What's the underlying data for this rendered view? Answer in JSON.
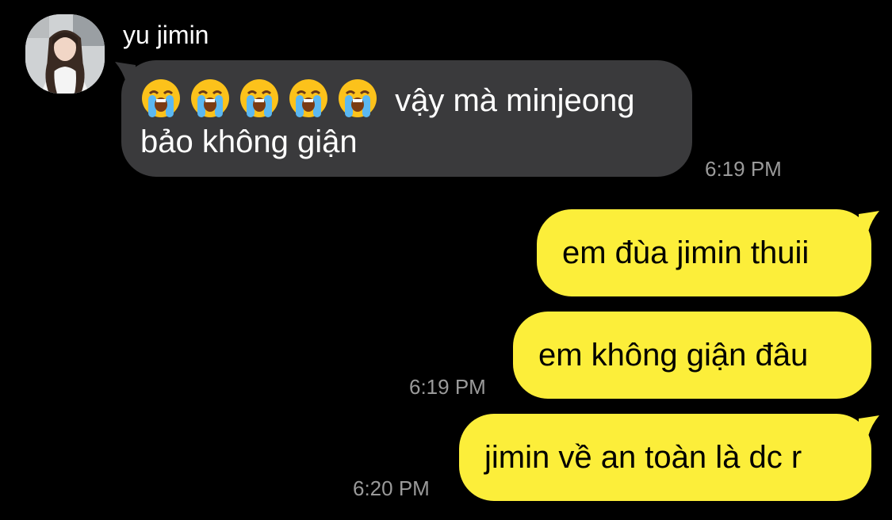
{
  "conversation": {
    "contact_name": "yu jimin",
    "incoming_message": {
      "emojis": [
        "loudly-crying-face-emoji",
        "loudly-crying-face-emoji",
        "loudly-crying-face-emoji",
        "loudly-crying-face-emoji",
        "loudly-crying-face-emoji"
      ],
      "text": " vậy mà minjeong bảo không giận",
      "time": "6:19 PM"
    },
    "outgoing_messages": [
      {
        "text": "em đùa jimin thuii"
      },
      {
        "text": "em không giận đâu",
        "time": "6:19 PM"
      },
      {
        "text": "jimin về an toàn là dc r",
        "time": "6:20 PM"
      }
    ]
  },
  "colors": {
    "background": "#000000",
    "incoming_bubble": "#3a3a3c",
    "outgoing_bubble": "#fcee3a",
    "timestamp": "#9a9a9a"
  }
}
